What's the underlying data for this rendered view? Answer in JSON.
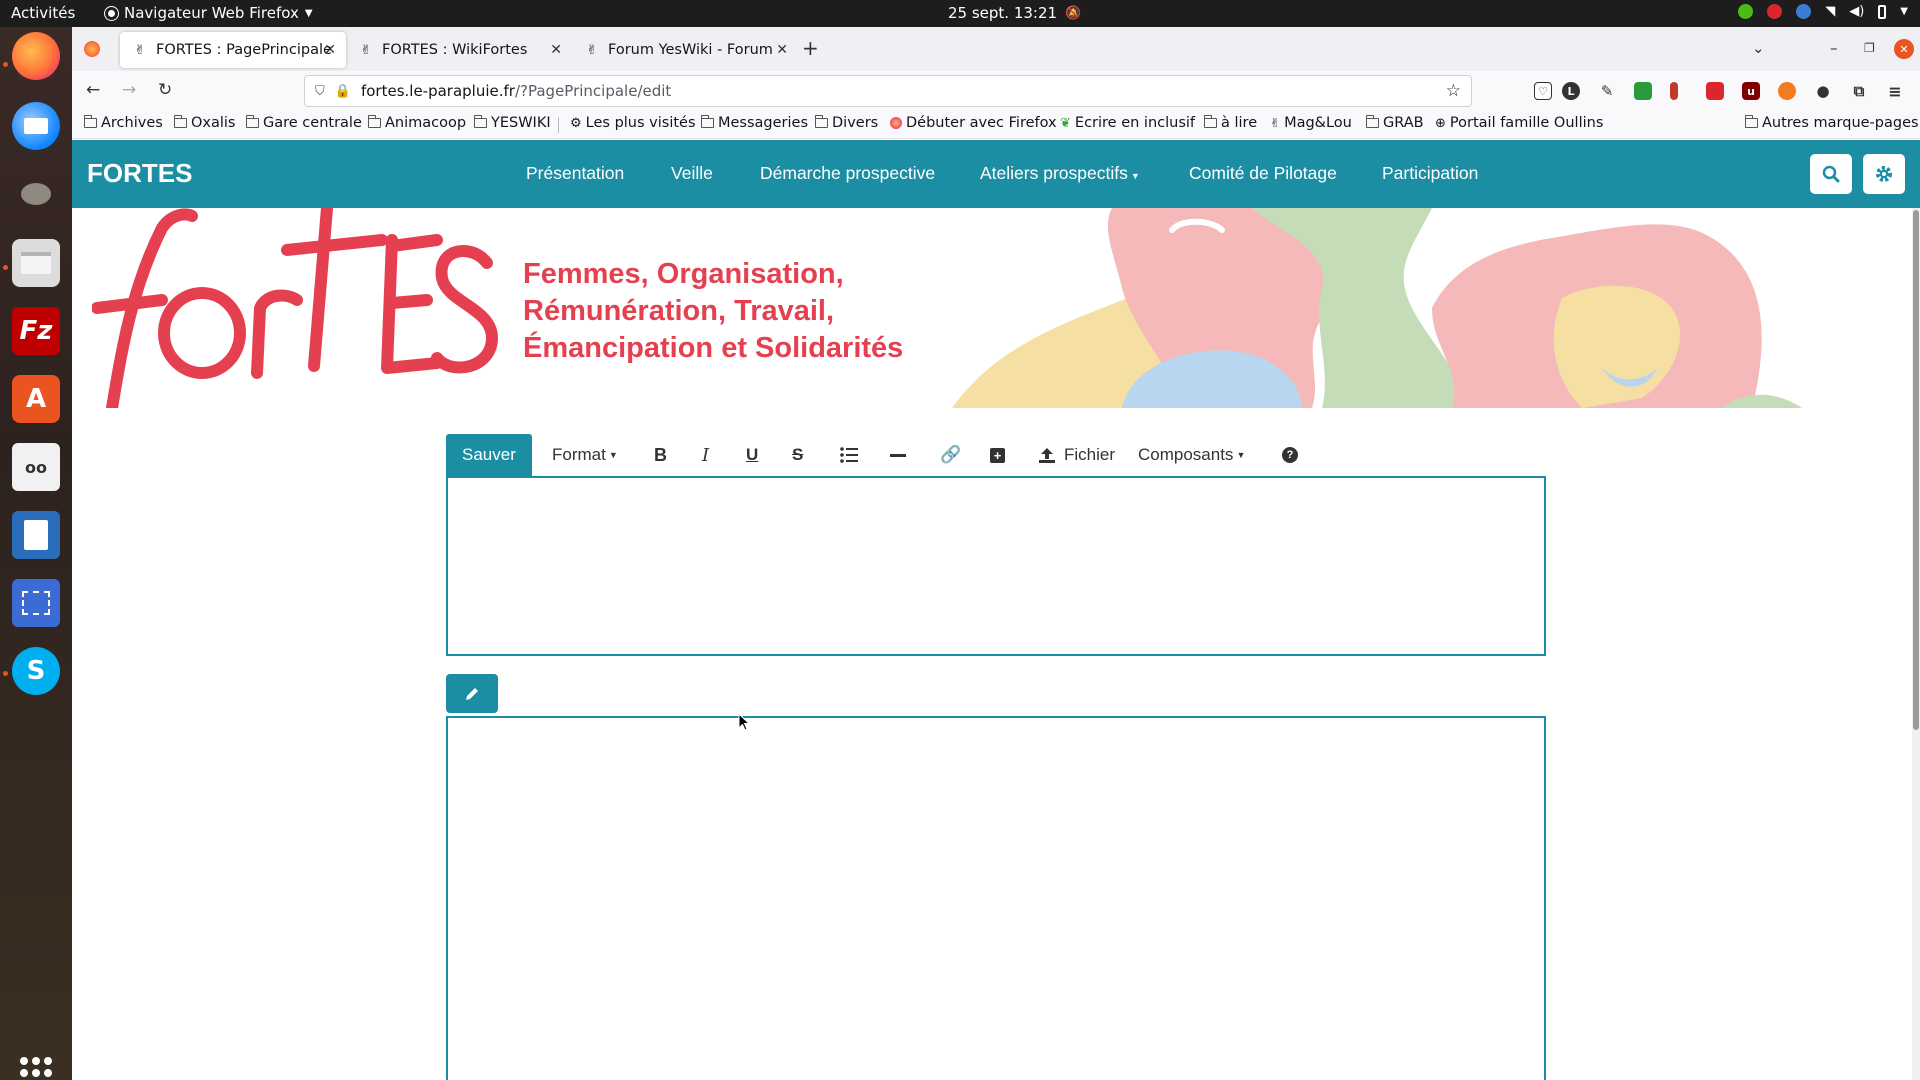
{
  "system": {
    "activities": "Activités",
    "app_menu": "Navigateur Web Firefox",
    "clock": "25 sept.  13:21"
  },
  "dock": {
    "items": [
      "firefox-icon",
      "thunderbird-icon",
      "gimp-icon",
      "files-icon",
      "filezilla-icon",
      "software-icon",
      "reader-icon",
      "writer-icon",
      "screenshot-icon",
      "skype-icon"
    ]
  },
  "browser": {
    "tabs": [
      {
        "title": "FORTES : PagePrincipale"
      },
      {
        "title": "FORTES : WikiFortes"
      },
      {
        "title": "Forum YesWiki - Forum Ye"
      }
    ],
    "url_host": "fortes.le-parapluie.fr",
    "url_rest": "/?PagePrincipale/edit",
    "bookmarks": [
      "Archives",
      "Oxalis",
      "Gare centrale",
      "Animacoop",
      "YESWIKI",
      "Les plus visités",
      "Messageries",
      "Divers",
      "Débuter avec Firefox",
      "Ecrire en inclusif",
      "à lire",
      "Mag&Lou",
      "GRAB",
      "Portail famille Oullins"
    ],
    "other_bookmarks": "Autres marque-pages"
  },
  "site": {
    "brand": "FORTES",
    "menu": [
      "Présentation",
      "Veille",
      "Démarche prospective",
      "Ateliers prospectifs",
      "Comité de Pilotage",
      "Participation"
    ],
    "banner_logo": "fortes",
    "tagline": [
      "Femmes, Organisation,",
      "Rémunération, Travail,",
      "Émancipation et Solidarités"
    ]
  },
  "editor": {
    "save": "Sauver",
    "format": "Format",
    "file": "Fichier",
    "components": "Composants"
  },
  "colors": {
    "accent": "#1b8ea4",
    "brand_red": "#e5404f"
  }
}
